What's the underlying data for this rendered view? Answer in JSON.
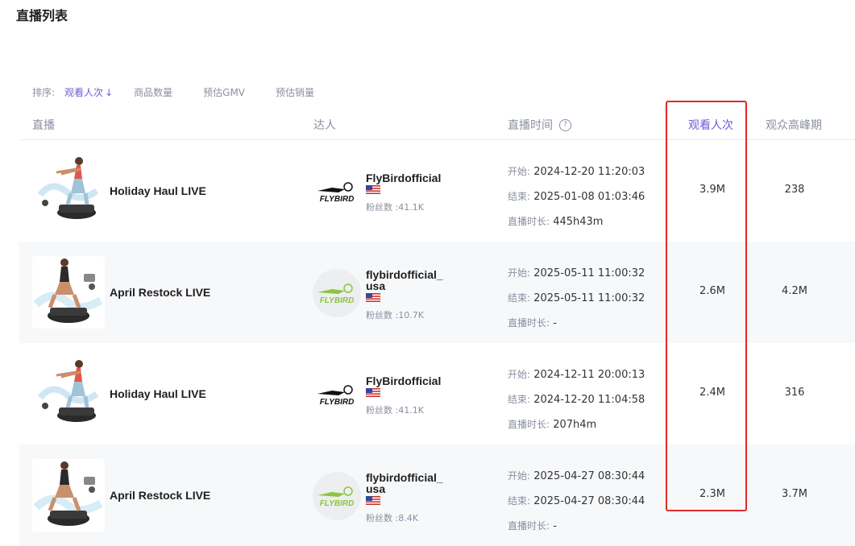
{
  "page": {
    "title": "直播列表"
  },
  "sort": {
    "label": "排序:",
    "options": [
      {
        "label": "观看人次",
        "arrow": "↓",
        "active": true
      },
      {
        "label": "商品数量"
      },
      {
        "label": "预估GMV"
      },
      {
        "label": "预估销量"
      }
    ]
  },
  "headers": {
    "live": "直播",
    "creator": "达人",
    "time": "直播时间",
    "time_help": "?",
    "views": "观看人次",
    "peak": "观众高峰期"
  },
  "labels": {
    "start": "开始:",
    "end": "结束:",
    "duration": "直播时长:"
  },
  "logo_text": "FLYBIRD",
  "rows": [
    {
      "title": "Holiday Haul LIVE",
      "creator": "FlyBirdofficial",
      "fans": "粉丝数 :41.1K",
      "start": "2024-12-20 11:20:03",
      "end": "2025-01-08 01:03:46",
      "duration": "445h43m",
      "views": "3.9M",
      "peak": "238"
    },
    {
      "title": "April Restock LIVE",
      "creator": "flybirdofficial_usa",
      "fans": "粉丝数 :10.7K",
      "start": "2025-05-11 11:00:32",
      "end": "2025-05-11 11:00:32",
      "duration": "-",
      "views": "2.6M",
      "peak": "4.2M"
    },
    {
      "title": "Holiday Haul LIVE",
      "creator": "FlyBirdofficial",
      "fans": "粉丝数 :41.1K",
      "start": "2024-12-11 20:00:13",
      "end": "2024-12-20 11:04:58",
      "duration": "207h4m",
      "views": "2.4M",
      "peak": "316"
    },
    {
      "title": "April Restock LIVE",
      "creator": "flybirdofficial_usa",
      "fans": "粉丝数 :8.4K",
      "start": "2025-04-27 08:30:44",
      "end": "2025-04-27 08:30:44",
      "duration": "-",
      "views": "2.3M",
      "peak": "3.7M"
    }
  ],
  "colors": {
    "accent": "#6b5bd6",
    "highlight": "#e02a2a",
    "logo_green": "#8cc63f"
  }
}
